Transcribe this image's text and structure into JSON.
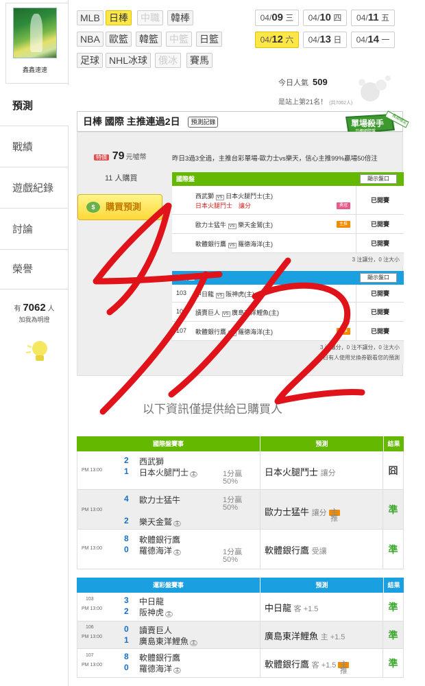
{
  "sidebar": {
    "username": "鑫鑫速速",
    "nav": [
      {
        "label": "預測"
      },
      {
        "label": "戰績"
      },
      {
        "label": "遊戲紀錄"
      },
      {
        "label": "討論"
      },
      {
        "label": "榮譽"
      }
    ],
    "fans_prefix": "有",
    "fans_count": "7062",
    "fans_suffix": "人",
    "fans_sub": "加我為明燈"
  },
  "sports_row1": [
    "MLB",
    "日棒",
    "中職",
    "韓棒"
  ],
  "sports_row2": [
    "NBA",
    "歐籃",
    "韓籃",
    "中籃",
    "日籃"
  ],
  "sports_row3": [
    "足球",
    "NHL冰球",
    "俄冰",
    "賽馬"
  ],
  "dates": [
    {
      "md": "04/",
      "day": "09",
      "wd": "三"
    },
    {
      "md": "04/",
      "day": "10",
      "wd": "四"
    },
    {
      "md": "04/",
      "day": "11",
      "wd": "五"
    },
    {
      "md": "04/",
      "day": "12",
      "wd": "六"
    },
    {
      "md": "04/",
      "day": "13",
      "wd": "日"
    },
    {
      "md": "04/",
      "day": "14",
      "wd": "一"
    }
  ],
  "popularity_label": "今日人氣",
  "popularity_value": "509",
  "rank_text": "是站上第21名！",
  "rank_small": "(共7062人)",
  "panel": {
    "title": "日棒 國際 主推連過2日",
    "history_btn": "預測記錄",
    "badge_main": "單場殺手",
    "badge_sub": "日棒國際盤",
    "badge_ribbon": "長期穩定",
    "price_tag": "特價",
    "price": "79",
    "price_unit": "元噓幣",
    "buyers": "11 人購買",
    "buy_btn": "購買預測",
    "buy_icon": "$",
    "summary": "昨日3過3全過，主推台彩單場-歐力士vs樂天，信心主推99%贏場50倍注"
  },
  "intl_table": {
    "title": "國際盤",
    "show_btn": "顯示盤口",
    "rows": [
      {
        "away": "西武獅",
        "home": "日本火腿鬥士(主)",
        "pick": "日本火腿鬥士　讓分",
        "tag": "勇冠",
        "status": "已開賽"
      },
      {
        "away": "歐力士猛牛",
        "home": "樂天金鷲(主)",
        "pick": "",
        "tag": "主推",
        "status": "已開賽"
      },
      {
        "away": "軟體銀行鷹",
        "home": "羅德海洋(主)",
        "pick": "",
        "tag": "",
        "status": "已開賽"
      }
    ],
    "footer": "3 注讓分，0 注大小"
  },
  "lottery_table": {
    "title": "運彩盤",
    "show_btn": "顯示盤口",
    "rows": [
      {
        "no": "103",
        "away": "中日龍",
        "home": "阪神虎(主)",
        "tag": "",
        "status": "已開賽"
      },
      {
        "no": "106",
        "away": "讀賣巨人",
        "home": "廣島東洋鯉魚(主)",
        "tag": "",
        "status": "已開賽"
      },
      {
        "no": "107",
        "away": "軟體銀行鷹",
        "home": "羅德海洋(主)",
        "tag": "主推",
        "status": "已開賽"
      }
    ],
    "footer": "3 注讓分，0 注不讓分，0 注大小",
    "footer2": "今日有人使用兌換券觀看您的預測"
  },
  "promo_text": "以下資訊僅提供給已購買人",
  "intl_results": {
    "head_game": "國際盤賽事",
    "head_pred": "預測",
    "head_result": "結果",
    "rows": [
      {
        "time": "PM 13:00",
        "away_score": "2",
        "away": "西武獅",
        "home_score": "1",
        "home": "日本火腿鬥士",
        "odds_a": "1分贏",
        "odds_b": "50%",
        "pred": "日本火腿鬥士",
        "pred_type": "讓分",
        "tag": "",
        "result": "囧"
      },
      {
        "time": "PM 13:00",
        "away_score": "4",
        "away": "歐力士猛牛",
        "home_score": "2",
        "home": "樂天金鷲",
        "odds_a": "1分贏",
        "odds_b": "50%",
        "pred": "歐力士猛牛",
        "pred_type": "讓分",
        "tag": "主推",
        "result": "準"
      },
      {
        "time": "PM 13:00",
        "away_score": "8",
        "away": "軟體銀行鷹",
        "home_score": "0",
        "home": "羅德海洋",
        "odds_a": "1分贏",
        "odds_b": "50%",
        "pred": "軟體銀行鷹",
        "pred_type": "受讓",
        "tag": "",
        "result": "準"
      }
    ]
  },
  "lottery_results": {
    "head_game": "運彩盤賽事",
    "head_pred": "預測",
    "head_result": "結果",
    "rows": [
      {
        "no": "103",
        "time": "PM 13:00",
        "away_score": "3",
        "away": "中日龍",
        "home_score": "2",
        "home": "阪神虎",
        "pred": "中日龍",
        "pred_type": "客 +1.5",
        "tag": "",
        "result": "準"
      },
      {
        "no": "106",
        "time": "PM 13:00",
        "away_score": "0",
        "away": "讀賣巨人",
        "home_score": "1",
        "home": "廣島東洋鯉魚",
        "pred": "廣島東洋鯉魚",
        "pred_type": "主 +1.5",
        "tag": "",
        "result": "準"
      },
      {
        "no": "107",
        "time": "PM 13:00",
        "away_score": "8",
        "away": "軟體銀行鷹",
        "home_score": "0",
        "home": "羅德海洋",
        "pred": "軟體銀行鷹",
        "pred_type": "客 +1.5",
        "tag": "主推",
        "result": "準"
      }
    ]
  },
  "home_mark": "主",
  "vs_mark": "VS",
  "colors": {
    "accent_yellow": "#ffe74a",
    "green_head": "#64b800",
    "blue_head": "#1a9fe0",
    "hit": "#3aa82a",
    "scribble": "#e0121a"
  }
}
